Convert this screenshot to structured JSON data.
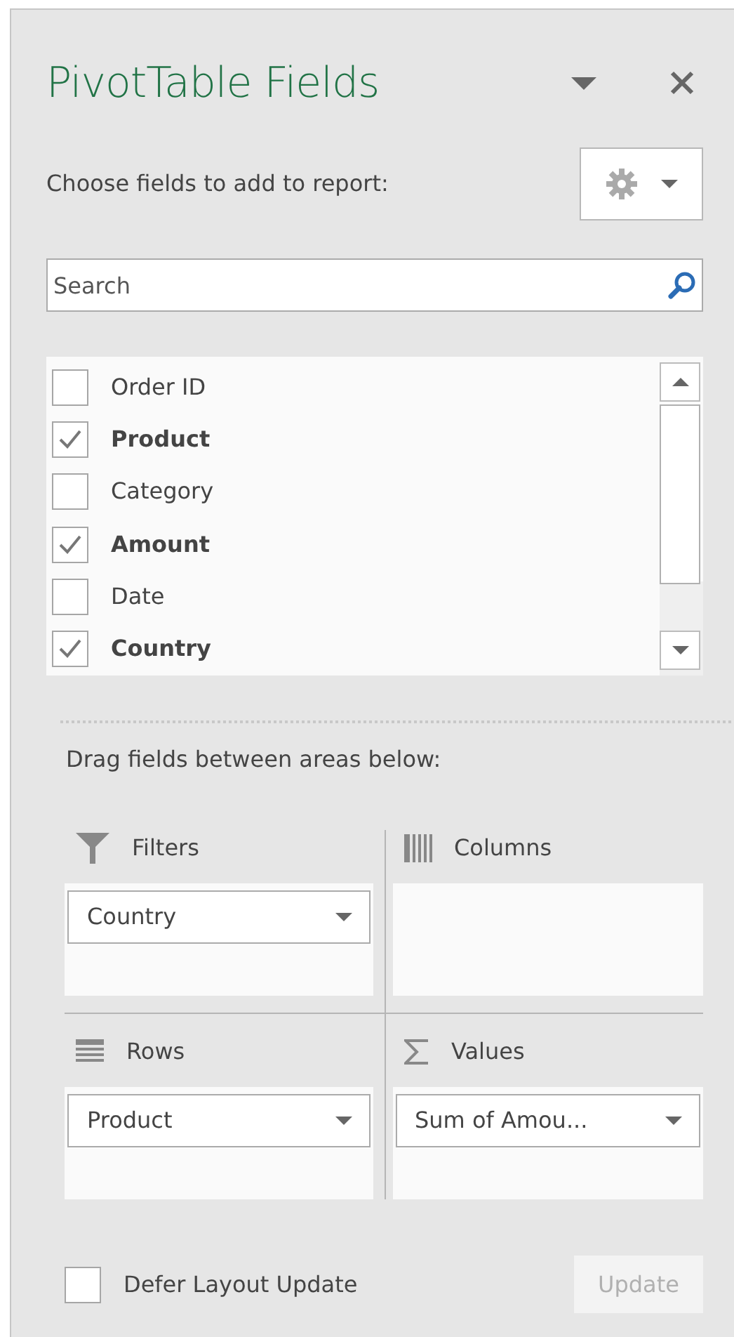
{
  "panel": {
    "title": "PivotTable Fields",
    "subtitle": "Choose fields to add to report:"
  },
  "search": {
    "placeholder": "Search"
  },
  "fields": [
    {
      "label": "Order ID",
      "checked": false
    },
    {
      "label": "Product",
      "checked": true
    },
    {
      "label": "Category",
      "checked": false
    },
    {
      "label": "Amount",
      "checked": true
    },
    {
      "label": "Date",
      "checked": false
    },
    {
      "label": "Country",
      "checked": true
    }
  ],
  "drag_label": "Drag fields between areas below:",
  "areas": [
    {
      "kind": "filters",
      "title": "Filters",
      "items": [
        "Country"
      ]
    },
    {
      "kind": "columns",
      "title": "Columns"
    },
    {
      "kind": "rows",
      "title": "Rows",
      "items": [
        "Product"
      ]
    },
    {
      "kind": "values",
      "title": "Values",
      "items": [
        "Sum of Amou..."
      ]
    }
  ],
  "defer": {
    "label": "Defer Layout Update",
    "checked": false
  },
  "update_button": {
    "label": "Update",
    "disabled": true
  }
}
